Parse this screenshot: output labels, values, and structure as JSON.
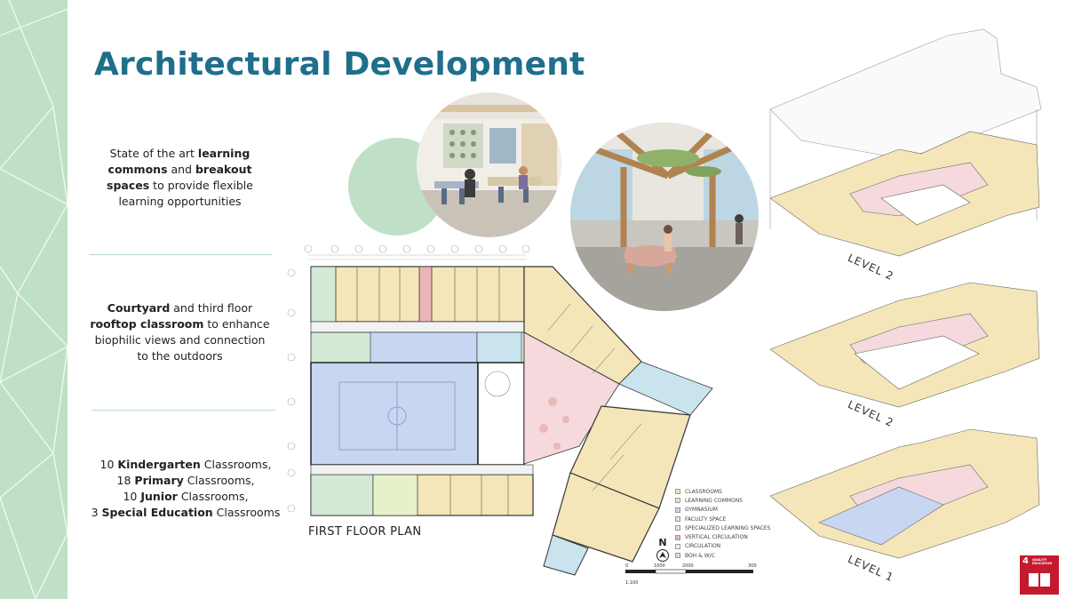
{
  "slide": {
    "title": "Architectural Development"
  },
  "blocks": [
    {
      "parts": [
        "State of the art ",
        "learning commons",
        " and ",
        "breakout spaces",
        " to provide flexible learning opportunities"
      ]
    },
    {
      "parts": [
        "Courtyard",
        " and third floor ",
        "rooftop classroom",
        " to enhance biophilic views and connection to the outdoors"
      ]
    },
    {
      "lines": [
        [
          "10 ",
          "Kindergarten",
          " Classrooms,"
        ],
        [
          "18 ",
          "Primary",
          " Classrooms,"
        ],
        [
          "10 ",
          "Junior",
          " Classrooms,"
        ],
        [
          "3 ",
          "Special Education",
          " Classrooms"
        ]
      ]
    }
  ],
  "plan": {
    "label": "FIRST FLOOR PLAN",
    "north": "N"
  },
  "legend": [
    {
      "label": "CLASSROOMS",
      "color": "#f4e6b8"
    },
    {
      "label": "LEARNING COMMONS",
      "color": "#f6d9dc"
    },
    {
      "label": "GYMNASIUM",
      "color": "#c8d6f2"
    },
    {
      "label": "FACULTY SPACE",
      "color": "#d3e9d5"
    },
    {
      "label": "SPECIALIZED LEARNING SPACES",
      "color": "#e6f1c9"
    },
    {
      "label": "VERTICAL CIRCULATION",
      "color": "#ecb4b8"
    },
    {
      "label": "CIRCULATION",
      "color": "#f2f2f2"
    },
    {
      "label": "BOH & W/C",
      "color": "#c9e4ee"
    }
  ],
  "scale": {
    "ticks": [
      "0",
      "1000",
      "2000",
      "3000"
    ],
    "ratio": "1:100"
  },
  "axo_levels": [
    "LEVEL 2",
    "LEVEL 2",
    "LEVEL 1"
  ],
  "sdg": {
    "number": "4",
    "text": "QUALITY EDUCATION",
    "color": "#c5192d"
  },
  "colors": {
    "title": "#1f6e8c",
    "band": "#bfe0c6",
    "divider": "#b9dcc2"
  }
}
